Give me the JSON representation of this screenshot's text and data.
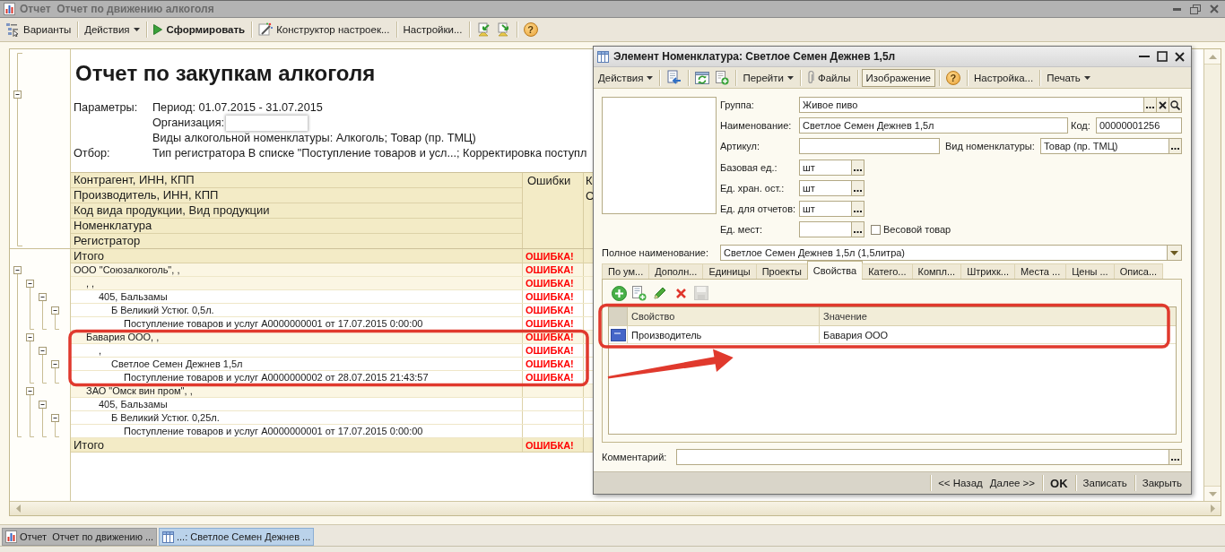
{
  "window": {
    "title": "Отчет  Отчет по движению алкоголя"
  },
  "toolbar": [
    {
      "kind": "icon-button",
      "label": "Варианты"
    },
    {
      "kind": "separator"
    },
    {
      "kind": "menu",
      "label": "Действия"
    },
    {
      "kind": "separator"
    },
    {
      "kind": "primary",
      "label": "Сформировать"
    },
    {
      "kind": "separator"
    },
    {
      "kind": "icon-button",
      "label": "Конструктор настроек..."
    },
    {
      "kind": "separator"
    },
    {
      "kind": "text",
      "label": "Настройки..."
    },
    {
      "kind": "separator"
    },
    {
      "kind": "icon"
    },
    {
      "kind": "icon"
    },
    {
      "kind": "separator"
    },
    {
      "kind": "help",
      "label": "?"
    }
  ],
  "report": {
    "title": "Отчет по закупкам алкоголя",
    "header_expanded": true,
    "parameters": [
      {
        "label": "Параметры:",
        "lines": [
          {
            "text": "Период: 01.07.2015 - 31.07.2015",
            "redacted": false
          },
          {
            "text": "Организация:",
            "redacted": true
          },
          {
            "text": "Виды алкогольной номенклатуры: Алкоголь; Товар (пр. ТМЦ)",
            "redacted": false
          }
        ]
      },
      {
        "label": "Отбор:",
        "lines": [
          {
            "text": "Тип регистратора В списке \"Поступление товаров и усл...; Корректировка поступл",
            "redacted": false
          }
        ]
      }
    ],
    "table": {
      "columns": [
        {
          "lines": [
            "Контрагент, ИНН, КПП",
            "Производитель, ИНН, КПП",
            "Код вида продукции, Вид продукции",
            "Номенклатура",
            "Регистратор"
          ]
        },
        {
          "lines": [
            "Ошибки"
          ]
        },
        {
          "lines": [
            "К",
            "С"
          ]
        }
      ],
      "rows": [
        {
          "kind": "total",
          "label": "Итого",
          "error": "ОШИБКА!"
        },
        {
          "kind": "group",
          "label": "ООО \"Союзалкоголь\", ,",
          "error": "ОШИБКА!",
          "expanded": true,
          "children": [
            {
              "kind": "group",
              "label": ", ,",
              "error": "ОШИБКА!",
              "expanded": true,
              "children": [
                {
                  "kind": "group",
                  "label": "405, Бальзамы",
                  "error": "ОШИБКА!",
                  "expanded": true,
                  "children": [
                    {
                      "kind": "group",
                      "label": "Б Великий Устюг. 0,5л.",
                      "error": "ОШИБКА!",
                      "expanded": true,
                      "children": [
                        {
                          "kind": "record",
                          "label": "Поступление товаров и услуг A0000000001 от 17.07.2015 0:00:00",
                          "error": "ОШИБКА!"
                        }
                      ]
                    }
                  ]
                }
              ]
            },
            {
              "kind": "group",
              "label": "Бавария ООО, ,",
              "error": "ОШИБКА!",
              "expanded": true,
              "children": [
                {
                  "kind": "group",
                  "label": ",",
                  "error": "ОШИБКА!",
                  "expanded": true,
                  "children": [
                    {
                      "kind": "group",
                      "label": "Светлое Семен Дежнев 1,5л",
                      "error": "ОШИБКА!",
                      "expanded": true,
                      "children": [
                        {
                          "kind": "record",
                          "label": "Поступление товаров и услуг A0000000002 от 28.07.2015 21:43:57",
                          "error": "ОШИБКА!"
                        }
                      ]
                    }
                  ]
                }
              ]
            },
            {
              "kind": "group",
              "label": "ЗАО \"Омск вин пром\", ,",
              "expanded": true,
              "children": [
                {
                  "kind": "group",
                  "label": "405, Бальзамы",
                  "expanded": true,
                  "children": [
                    {
                      "kind": "group",
                      "label": "Б Великий Устюг. 0,25л.",
                      "expanded": true,
                      "children": [
                        {
                          "kind": "record",
                          "label": "Поступление товаров и услуг A0000000001 от 17.07.2015 0:00:00"
                        }
                      ]
                    }
                  ]
                }
              ]
            }
          ]
        },
        {
          "kind": "total",
          "label": "Итого",
          "error": "ОШИБКА!"
        }
      ]
    }
  },
  "dialog": {
    "title": "Элемент Номенклатура: Светлое Семен Дежнев 1,5л",
    "toolbar": [
      {
        "kind": "menu",
        "label": "Действия"
      },
      {
        "kind": "separator"
      },
      {
        "kind": "icon"
      },
      {
        "kind": "separator"
      },
      {
        "kind": "icon"
      },
      {
        "kind": "icon"
      },
      {
        "kind": "separator"
      },
      {
        "kind": "menu",
        "label": "Перейти"
      },
      {
        "kind": "separator"
      },
      {
        "kind": "icon-button",
        "label": "Файлы"
      },
      {
        "kind": "separator"
      },
      {
        "kind": "toggle",
        "label": "Изображение",
        "pressed": true
      },
      {
        "kind": "separator"
      },
      {
        "kind": "help",
        "label": "?"
      },
      {
        "kind": "separator"
      },
      {
        "kind": "text",
        "label": "Настройка..."
      },
      {
        "kind": "separator"
      },
      {
        "kind": "menu",
        "label": "Печать"
      }
    ],
    "group": {
      "label": "Группа:",
      "value": "Живое пиво"
    },
    "name": {
      "label": "Наименование:",
      "value": "Светлое Семен Дежнев 1,5л"
    },
    "code": {
      "label": "Код:",
      "value": "00000001256"
    },
    "article": {
      "label": "Артикул:"
    },
    "item_type": {
      "label": "Вид номенклатуры:",
      "value": "Товар (пр. ТМЦ)"
    },
    "units": [
      {
        "label": "Базовая ед.:",
        "value": "шт"
      },
      {
        "label": "Ед. хран. ост.:",
        "value": "шт"
      },
      {
        "label": "Ед. для отчетов:",
        "value": "шт"
      },
      {
        "label": "Ед. мест:"
      }
    ],
    "weight_item": {
      "label": "Весовой товар",
      "checked": false
    },
    "full_name": {
      "label": "Полное наименование:",
      "value": "Светлое Семен Дежнев 1,5л (1,5литра)"
    },
    "tabs": [
      {
        "label": "По ум...",
        "selected": false
      },
      {
        "label": "Дополн...",
        "selected": false
      },
      {
        "label": "Единицы",
        "selected": false
      },
      {
        "label": "Проекты",
        "selected": false
      },
      {
        "label": "Свойства",
        "selected": true
      },
      {
        "label": "Катего...",
        "selected": false
      },
      {
        "label": "Компл...",
        "selected": false
      },
      {
        "label": "Штрихк...",
        "selected": false
      },
      {
        "label": "Места ...",
        "selected": false
      },
      {
        "label": "Цены ...",
        "selected": false
      },
      {
        "label": "Описа...",
        "selected": false
      }
    ],
    "tab_toolbar": [
      {
        "disabled": false
      },
      {
        "disabled": false
      },
      {
        "disabled": false
      },
      {
        "disabled": false
      },
      {
        "disabled": true
      }
    ],
    "properties": {
      "columns": [
        "Свойство",
        "Значение"
      ],
      "rows": [
        {
          "cells": [
            "Производитель",
            "Бавария ООО"
          ]
        }
      ]
    },
    "comment": {
      "label": "Комментарий:"
    },
    "buttons": [
      {
        "kind": "separator"
      },
      {
        "kind": "text",
        "label": "<< Назад"
      },
      {
        "kind": "text",
        "label": "Далее >>"
      },
      {
        "kind": "separator"
      },
      {
        "kind": "default",
        "label": "OK"
      },
      {
        "kind": "separator"
      },
      {
        "kind": "text",
        "label": "Записать"
      },
      {
        "kind": "separator"
      },
      {
        "kind": "text",
        "label": "Закрыть"
      }
    ]
  },
  "annotations": [
    {
      "kind": "frame"
    },
    {
      "kind": "frame"
    },
    {
      "kind": "arrow"
    }
  ],
  "taskbar": [
    {
      "label": "Отчет  Отчет по движению ...",
      "selected": false
    },
    {
      "label": "...: Светлое Семен Дежнев ...",
      "selected": true
    }
  ]
}
